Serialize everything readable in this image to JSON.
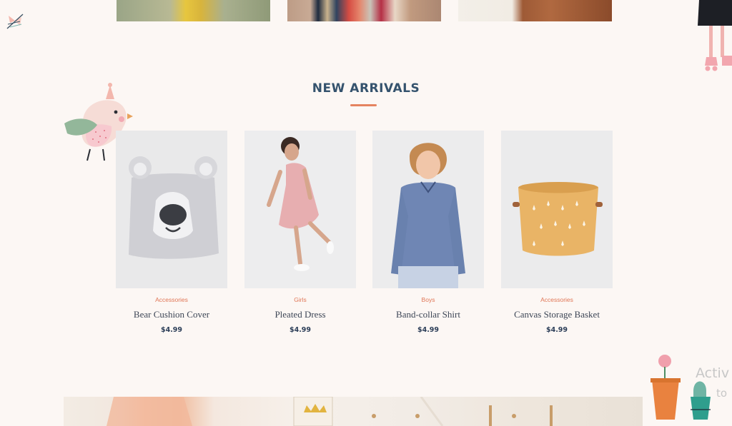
{
  "section": {
    "title": "NEW ARRIVALS"
  },
  "products": [
    {
      "category": "Accessories",
      "name": "Bear Cushion Cover",
      "price": "$4.99",
      "image": "bear-cushion-image"
    },
    {
      "category": "Girls",
      "name": "Pleated Dress",
      "price": "$4.99",
      "image": "girl-pink-dress-image"
    },
    {
      "category": "Boys",
      "name": "Band-collar Shirt",
      "price": "$4.99",
      "image": "boy-blue-shirt-image"
    },
    {
      "category": "Accessories",
      "name": "Canvas Storage Basket",
      "price": "$4.99",
      "image": "storage-basket-image"
    }
  ],
  "overlay": {
    "watermark": "Activ",
    "watermark_sub": "to"
  },
  "colors": {
    "accent": "#e07656",
    "title": "#34526d",
    "background": "#fcf7f4"
  }
}
